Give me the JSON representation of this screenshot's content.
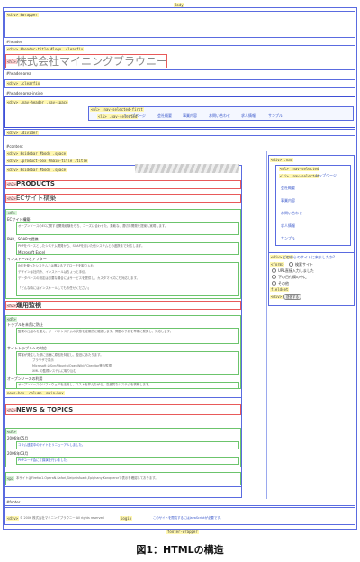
{
  "labels": {
    "body": "Body",
    "wrapper": "<div> #wrapper",
    "header": "#header",
    "header_inner": "<div> #header-title #logo .clearfix",
    "logo_h1": "<h1>",
    "company": "株式会社マイニングブラウニー",
    "header_area": "#header-area",
    "clearfix": "<div> .clearfix",
    "global_nav": "#header-area-inside",
    "nav_div": "<div> .nav-header .nav-space",
    "nav_ul": "<ul> .nav-selected-first",
    "nav_li": "<li> .nav-selected",
    "divider": "<div> .divider",
    "content": "#content",
    "content_div": "<div> #sidebar #body .space",
    "main_div": "<div> .product-box #main-title .title",
    "products_h2": "<h2>",
    "products": "PRODUCTS",
    "ec_h2": "<h2>",
    "ec": "ECサイト構築",
    "dl": "<dl>",
    "news_label": "news-box .column .main-box",
    "news_h2": "<h2>",
    "news": "NEWS & TOPICS",
    "sidebar_div": "<div> .nav",
    "sidebar_ul": "<ul> .nav-selected",
    "sidebar_li": "<li> .nav-selected",
    "form_div": "<div> .nav",
    "form_p": "<form>",
    "fieldset": "fieldset",
    "submit": "<div>",
    "footer": "#footer",
    "footer_div": "<div>",
    "footer_text": "© 2006 株式会社マイニングブラウニー All rights reserved",
    "footer_login": "login",
    "footer_note": "このサイトを閲覧するにはJavaScriptが必要です。",
    "footer_wrap": "footer-wrapper"
  },
  "nav": {
    "items": [
      "トップページ",
      "会社概要",
      "事業内容",
      "お問い合わせ",
      "求人情報",
      "サンプル",
      "サイトマップ"
    ]
  },
  "sidebar": {
    "items": [
      "トップページ",
      "会社概要",
      "事業内容",
      "お問い合わせ",
      "求人情報",
      "サンプル"
    ],
    "question": "どこからのサイトに来ましたか?",
    "radios": [
      "検索サイト",
      "URL直接入力しました",
      "下の日付欄の中に",
      "その他"
    ],
    "button": "送信する"
  },
  "body": {
    "dt1": "ECサイト構築",
    "dd1": "オープンソースのECに関する開発経験をもち、ニーズに合わせた、柔軟な、適切な開発を提案し実現します。",
    "dt2": "PHP、SOAPで提携",
    "dd2": "PHPをベースとしたシステム開発から、SOAPを用いた他システムとの連携まで対応します。",
    "dd2b": "Microsoft Excel",
    "dt3": "インストールとアフター",
    "dd3": "IMEを使ったシステムとは異なるアプローチを取り入れ、",
    "dd3b": "デザインは社内外、インストールはちょっと手伝。",
    "dd3c": "データベースの設定は必要な場合にはサービスを提供し、カスタマイズにも対応します。",
    "dd3d": "「どんな時にはインストールしてもお任せください」",
    "sec2": "運用監視",
    "dt4": "トラブルを未然に防止",
    "dd4": "監視の仕組みを整え、サーバやシステムの状態を定期的に確認します。問題の予兆を早期に発見し、対応します。",
    "dt5": "サイトトラブルへの対応",
    "dd5": "障害が発生した際に迅速に原因を特定し、復旧にあたります。",
    "dd5b": "ブラウザで表示",
    "dd5c": "Microsoft のSvn/Ubuntu/OpenWiki/FCkeditor等の監視",
    "dd5d": "XML の監視システムに取り込む",
    "dt6": "オープンソースの利用",
    "dd6": "オープンソースのソフトウェアを活用し、コストを抑えながら、高品質なシステムを構築します。",
    "news1d": "2006年05月",
    "news1": "コラム連載中のサイトをリニューアルしました。",
    "news2d": "2006年03月",
    "news2": "PHPユーザ会にて講演を行いました。",
    "tested": "本サイトはFirefox1.OperaN.Safari,SleipnirAvant,Epiphany,Konquerorで表示を確認しております。"
  },
  "caption": "図1：HTMLの構造"
}
